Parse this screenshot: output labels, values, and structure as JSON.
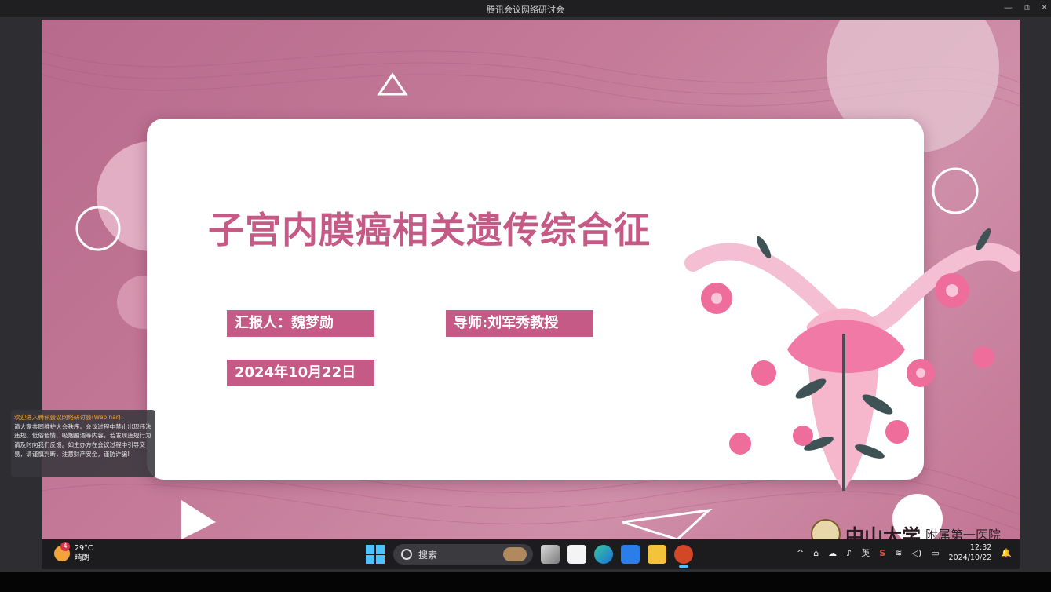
{
  "window": {
    "title": "腾讯会议网络研讨会",
    "controls": {
      "minimize": "—",
      "restore": "⧉",
      "close": "✕"
    }
  },
  "slide": {
    "title": "子宫内膜癌相关遗传综合征",
    "reporter": "汇报人：魏梦勋",
    "advisor": "导师:刘军秀教授",
    "date": "2024年10月22日",
    "logo": {
      "school": "中山大学",
      "affiliate": "附属第一医院"
    }
  },
  "notice": {
    "heading": "欢迎进入腾讯会议网络研讨会(Webinar)!",
    "body": "请大家共同维护大会秩序。会议过程中禁止出现违法违规、低俗色情、吸烟酗酒等内容，若发现违规行为请及时向我们反馈。如主办方在会议过程中引导交易，请谨慎判断，注意财产安全，谨防诈骗!"
  },
  "taskbar": {
    "weather": {
      "badge": "4",
      "temp": "29°C",
      "condition": "晴朗"
    },
    "search_placeholder": "搜索",
    "ime": "英",
    "time": "12:32",
    "date": "2024/10/22"
  },
  "colors": {
    "slide_pink": "#c47a98",
    "title_pink": "#c45a85",
    "taskbar": "#1c1c1f",
    "accent_blue": "#4cc2ff"
  }
}
